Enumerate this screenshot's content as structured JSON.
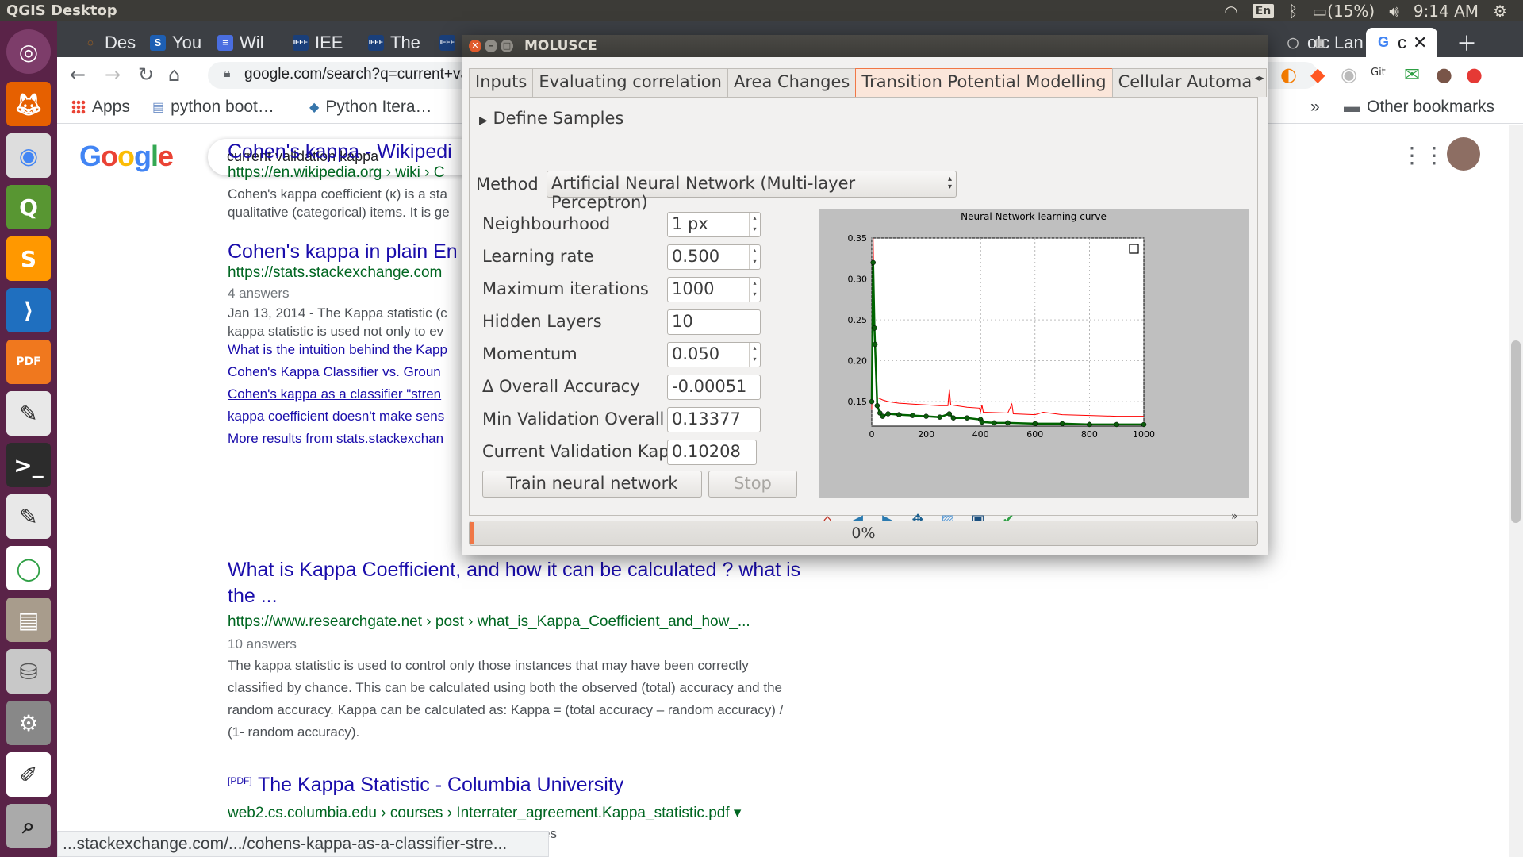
{
  "topbar": {
    "app_title": "QGIS Desktop",
    "lang": "En",
    "battery": "(15%)",
    "time": "9:14 AM"
  },
  "browser": {
    "tabs": [
      {
        "label": "Des",
        "icon": "loading-icon"
      },
      {
        "label": "You",
        "icon": "stackexchange-icon"
      },
      {
        "label": "Wil",
        "icon": "doc-icon"
      },
      {
        "label": "IEE",
        "icon": "ieee-icon"
      },
      {
        "label": "The",
        "icon": "ieee-icon"
      },
      {
        "label": "olc",
        "icon": "tab-icon"
      },
      {
        "label": "Lan",
        "icon": "tab-icon"
      },
      {
        "label": "c",
        "icon": "google-icon"
      }
    ],
    "url": "google.com/search?q=current+val",
    "bookmarks": [
      "Apps",
      "python boot…",
      "Python Itera…",
      "»",
      "Other bookmarks"
    ]
  },
  "google": {
    "query": "current validation kappa",
    "results": [
      {
        "title": "Cohen's kappa - Wikipedi",
        "url": "https://en.wikipedia.org › wiki › C",
        "text": [
          "Cohen's kappa coefficient (κ) is a sta",
          "qualitative (categorical) items. It is ge"
        ]
      },
      {
        "title": "Cohen's kappa in plain En",
        "url": "https://stats.stackexchange.com",
        "meta": "4 answers",
        "text": [
          "Jan 13, 2014 - The Kappa statistic (c",
          "kappa statistic is used not only to ev"
        ],
        "links": [
          "What is the intuition behind the Kapp",
          "Cohen's Kappa Classifier vs. Groun",
          "Cohen's kappa as a classifier \"stren",
          "kappa coefficient doesn't make sens",
          "More results from stats.stackexchan"
        ]
      },
      {
        "title": "What is Kappa Coefficient, and how it can be calculated ? what is",
        "title2": "the ...",
        "url": "https://www.researchgate.net › post › what_is_Kappa_Coefficient_and_how_...",
        "meta": "10 answers",
        "text": [
          "The kappa statistic is used to control only those instances that may have been correctly",
          "classified by chance. This can be calculated using both the observed (total) accuracy and the",
          "random accuracy. Kappa can be calculated as: Kappa = (total accuracy – random accuracy) /",
          "(1- random accuracy)."
        ]
      },
      {
        "badge": "[PDF]",
        "title": "The Kappa Statistic - Columbia University",
        "url": "web2.cs.columbia.edu › courses › Interrater_agreement.Kappa_statistic.pdf ▾",
        "text": [
          "es"
        ]
      }
    ],
    "status_url": "...stackexchange.com/.../cohens-kappa-as-a-classifier-stre..."
  },
  "dialog": {
    "title": "MOLUSCE",
    "tabs": [
      "Inputs",
      "Evaluating correlation",
      "Area Changes",
      "Transition Potential Modelling",
      "Cellular Automata"
    ],
    "active_tab": 3,
    "define_samples": "Define Samples",
    "method_label": "Method",
    "method_value": "Artificial Neural Network (Multi-layer Perceptron)",
    "params": [
      {
        "label": "Neighbourhood",
        "value": "1 px",
        "spin": true
      },
      {
        "label": "Learning rate",
        "value": "0.500",
        "spin": true
      },
      {
        "label": "Maximum iterations",
        "value": "1000",
        "spin": true
      },
      {
        "label": "Hidden Layers",
        "value": "10",
        "spin": false
      },
      {
        "label": "Momentum",
        "value": "0.050",
        "spin": true
      },
      {
        "label": "Δ Overall Accuracy",
        "value": "-0.00051",
        "spin": false
      },
      {
        "label": "Min Validation Overall Error",
        "value": "0.13377",
        "spin": false
      },
      {
        "label": "Current Validation Kappa",
        "value": "0.10208",
        "spin": false
      }
    ],
    "train_button": "Train neural network",
    "stop_button": "Stop",
    "progress": "0%",
    "progress_value": 0.0,
    "more": "»"
  },
  "chart_data": {
    "type": "line",
    "title": "Neural Network learning curve",
    "xlim": [
      0,
      1000
    ],
    "ylim": [
      0.12,
      0.35
    ],
    "xticks": [
      0,
      200,
      400,
      600,
      800,
      1000
    ],
    "yticks": [
      0.15,
      0.2,
      0.25,
      0.3,
      0.35
    ],
    "grid": true,
    "series": [
      {
        "color": "#ff0000",
        "points": [
          [
            0,
            0.14
          ],
          [
            5,
            0.35
          ],
          [
            10,
            0.25
          ],
          [
            15,
            0.2
          ],
          [
            20,
            0.155
          ],
          [
            40,
            0.152
          ],
          [
            60,
            0.15
          ],
          [
            100,
            0.148
          ],
          [
            150,
            0.147
          ],
          [
            200,
            0.146
          ],
          [
            250,
            0.145
          ],
          [
            280,
            0.145
          ],
          [
            285,
            0.165
          ],
          [
            290,
            0.146
          ],
          [
            350,
            0.143
          ],
          [
            395,
            0.142
          ],
          [
            400,
            0.137
          ],
          [
            405,
            0.146
          ],
          [
            410,
            0.137
          ],
          [
            500,
            0.136
          ],
          [
            515,
            0.147
          ],
          [
            520,
            0.135
          ],
          [
            600,
            0.134
          ],
          [
            630,
            0.137
          ],
          [
            700,
            0.134
          ],
          [
            800,
            0.133
          ],
          [
            900,
            0.132
          ],
          [
            1000,
            0.132
          ]
        ]
      },
      {
        "color": "#006400",
        "points": [
          [
            0,
            0.15
          ],
          [
            5,
            0.32
          ],
          [
            10,
            0.24
          ],
          [
            12,
            0.22
          ],
          [
            20,
            0.145
          ],
          [
            30,
            0.136
          ],
          [
            40,
            0.132
          ],
          [
            60,
            0.135
          ],
          [
            100,
            0.134
          ],
          [
            150,
            0.133
          ],
          [
            200,
            0.132
          ],
          [
            250,
            0.131
          ],
          [
            285,
            0.135
          ],
          [
            300,
            0.13
          ],
          [
            350,
            0.13
          ],
          [
            400,
            0.128
          ],
          [
            405,
            0.125
          ],
          [
            450,
            0.124
          ],
          [
            500,
            0.124
          ],
          [
            600,
            0.123
          ],
          [
            700,
            0.123
          ],
          [
            800,
            0.122
          ],
          [
            900,
            0.122
          ],
          [
            1000,
            0.122
          ]
        ]
      }
    ]
  }
}
